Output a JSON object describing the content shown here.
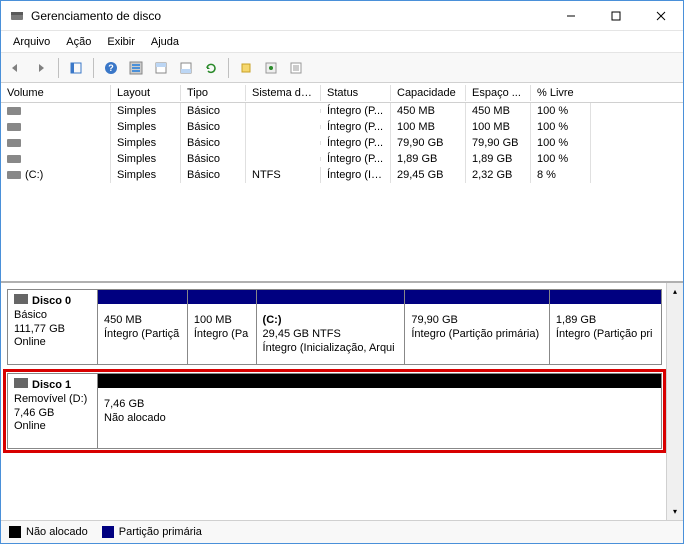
{
  "window": {
    "title": "Gerenciamento de disco"
  },
  "menu": {
    "file": "Arquivo",
    "action": "Ação",
    "view": "Exibir",
    "help": "Ajuda"
  },
  "columns": {
    "volume": "Volume",
    "layout": "Layout",
    "type": "Tipo",
    "fs": "Sistema de ...",
    "status": "Status",
    "capacity": "Capacidade",
    "free": "Espaço ...",
    "pct": "% Livre"
  },
  "volumes": [
    {
      "name": "",
      "layout": "Simples",
      "type": "Básico",
      "fs": "",
      "status": "Íntegro (P...",
      "capacity": "450 MB",
      "free": "450 MB",
      "pct": "100 %"
    },
    {
      "name": "",
      "layout": "Simples",
      "type": "Básico",
      "fs": "",
      "status": "Íntegro (P...",
      "capacity": "100 MB",
      "free": "100 MB",
      "pct": "100 %"
    },
    {
      "name": "",
      "layout": "Simples",
      "type": "Básico",
      "fs": "",
      "status": "Íntegro (P...",
      "capacity": "79,90 GB",
      "free": "79,90 GB",
      "pct": "100 %"
    },
    {
      "name": "",
      "layout": "Simples",
      "type": "Básico",
      "fs": "",
      "status": "Íntegro (P...",
      "capacity": "1,89 GB",
      "free": "1,89 GB",
      "pct": "100 %"
    },
    {
      "name": "(C:)",
      "layout": "Simples",
      "type": "Básico",
      "fs": "NTFS",
      "status": "Íntegro (Ini...",
      "capacity": "29,45 GB",
      "free": "2,32 GB",
      "pct": "8 %"
    }
  ],
  "disks": [
    {
      "name": "Disco 0",
      "type": "Básico",
      "size": "111,77 GB",
      "status": "Online",
      "highlight": false,
      "partitions": [
        {
          "label": "",
          "size": "450 MB",
          "status": "Íntegro (Partiçã",
          "barClass": "bar-primary",
          "flex": 8
        },
        {
          "label": "",
          "size": "100 MB",
          "status": "Íntegro (Pa",
          "barClass": "bar-primary",
          "flex": 6
        },
        {
          "label": "(C:)",
          "size": "29,45 GB NTFS",
          "status": "Íntegro (Inicialização, Arqui",
          "barClass": "bar-primary",
          "flex": 18
        },
        {
          "label": "",
          "size": "79,90 GB",
          "status": "Íntegro (Partição primária)",
          "barClass": "bar-primary",
          "flex": 18
        },
        {
          "label": "",
          "size": "1,89 GB",
          "status": "Íntegro (Partição pri",
          "barClass": "bar-primary",
          "flex": 12
        }
      ]
    },
    {
      "name": "Disco 1",
      "type": "Removível (D:)",
      "size": "7,46 GB",
      "status": "Online",
      "highlight": true,
      "partitions": [
        {
          "label": "",
          "size": "7,46 GB",
          "status": "Não alocado",
          "barClass": "bar-unalloc",
          "flex": 1
        }
      ]
    }
  ],
  "legend": {
    "unallocated": "Não alocado",
    "primary": "Partição primária"
  }
}
